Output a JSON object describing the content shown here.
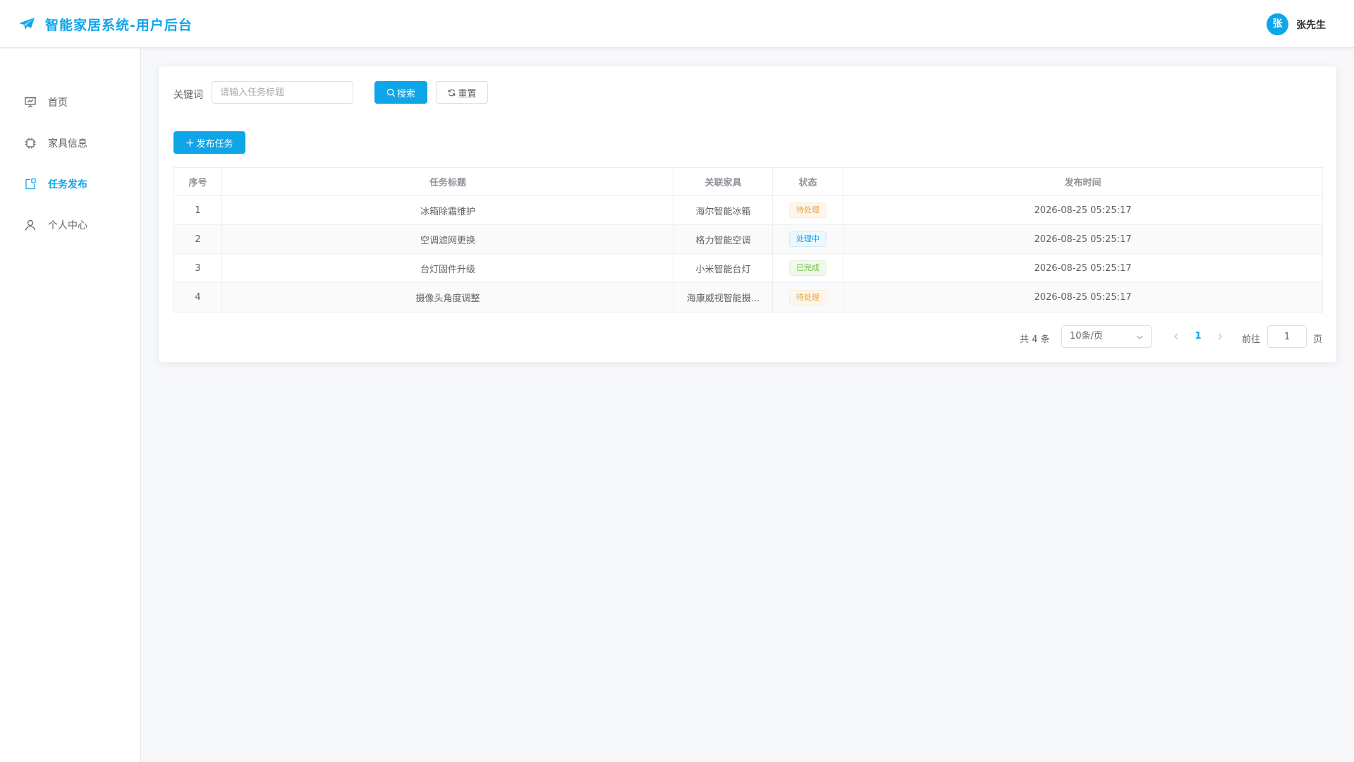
{
  "header": {
    "title": "智能家居系统-用户后台",
    "avatar_text": "张",
    "username": "张先生",
    "accent_color": "#0ea5e9"
  },
  "sidebar": {
    "items": [
      {
        "label": "首页",
        "icon": "presentation-chart-icon"
      },
      {
        "label": "家具信息",
        "icon": "cpu-chip-icon"
      },
      {
        "label": "任务发布",
        "icon": "notebook-publish-icon",
        "active": true
      },
      {
        "label": "个人中心",
        "icon": "user-icon"
      }
    ]
  },
  "search": {
    "keyword_label": "关键词",
    "placeholder": "请输入任务标题",
    "value": "",
    "search_label": "搜索",
    "reset_label": "重置"
  },
  "toolbar": {
    "publish_label": "发布任务"
  },
  "table": {
    "headers": [
      "序号",
      "任务标题",
      "关联家具",
      "状态",
      "发布时间"
    ],
    "rows": [
      {
        "index": "1",
        "title": "冰箱除霜维护",
        "furniture": "海尔智能冰箱",
        "status": "待处理",
        "status_type": "pending",
        "time": "2026-08-25 05:25:17"
      },
      {
        "index": "2",
        "title": "空调滤网更换",
        "furniture": "格力智能空调",
        "status": "处理中",
        "status_type": "processing",
        "time": "2026-08-25 05:25:17"
      },
      {
        "index": "3",
        "title": "台灯固件升级",
        "furniture": "小米智能台灯",
        "status": "已完成",
        "status_type": "done",
        "time": "2026-08-25 05:25:17"
      },
      {
        "index": "4",
        "title": "摄像头角度调整",
        "furniture": "海康威视智能摄...",
        "status": "待处理",
        "status_type": "pending",
        "time": "2026-08-25 05:25:17"
      }
    ]
  },
  "pagination": {
    "total_text": "共 4 条",
    "page_size": "10条/页",
    "current_page": "1",
    "goto_label": "前往",
    "goto_value": "1",
    "page_suffix": "页"
  }
}
